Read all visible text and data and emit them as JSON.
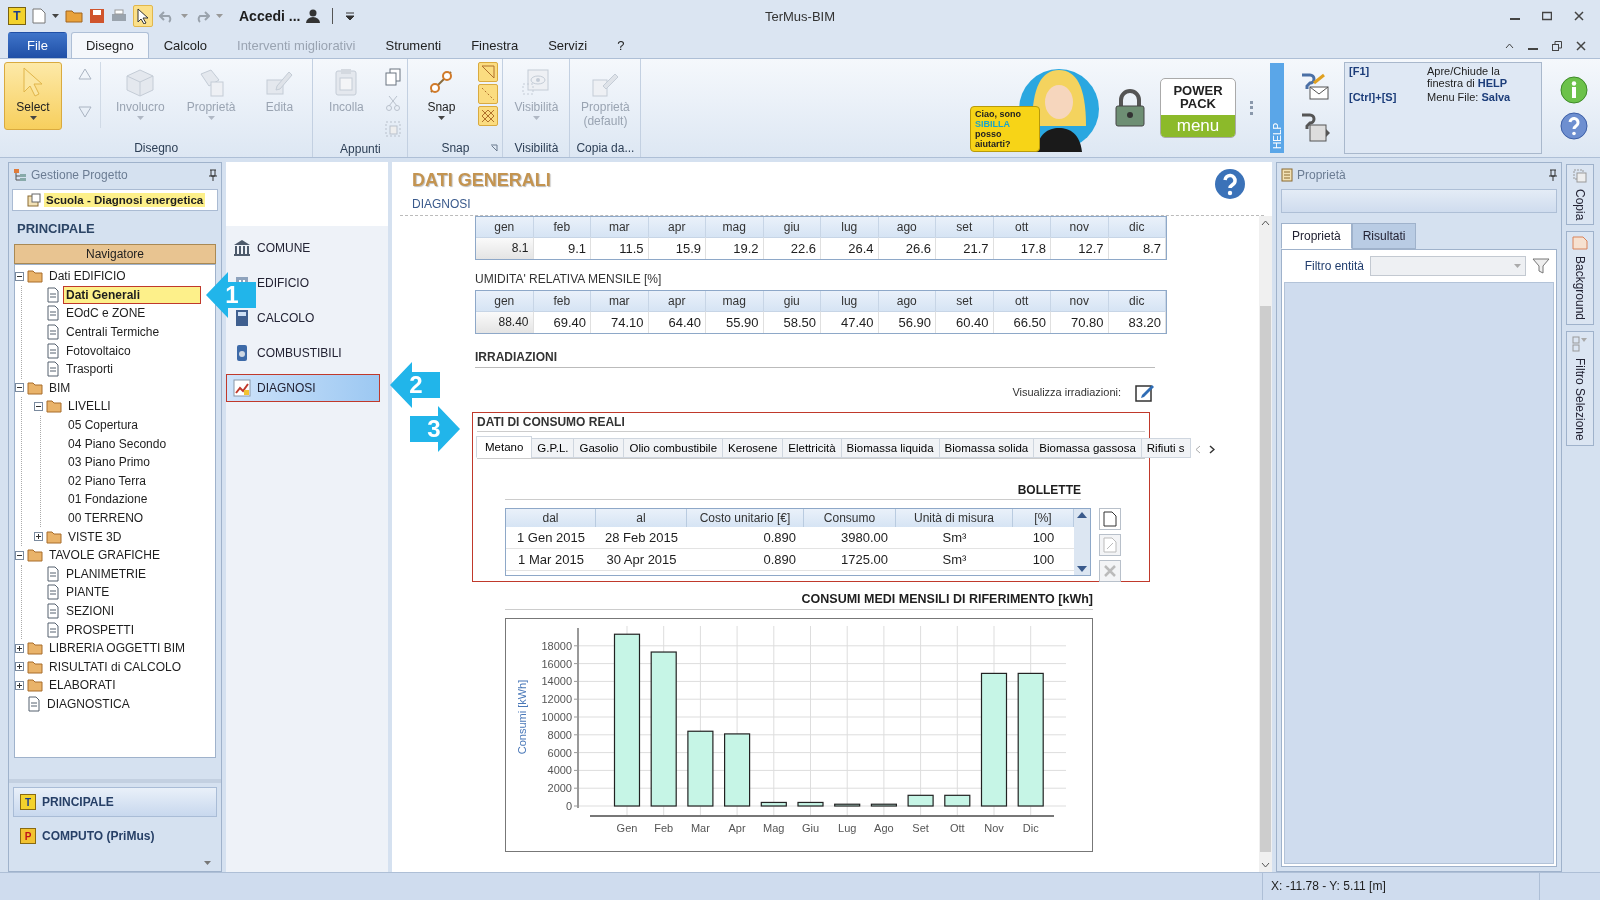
{
  "window": {
    "title": "TerMus-BIM",
    "app_logo": "T",
    "account": "Accedi ...",
    "pointer_tool_on": true
  },
  "ribbon_tabs": [
    {
      "label": "File",
      "kind": "file",
      "selected": false,
      "disabled": false
    },
    {
      "label": "Disegno",
      "kind": "tab",
      "selected": true,
      "disabled": false
    },
    {
      "label": "Calcolo",
      "kind": "tab",
      "selected": false,
      "disabled": false
    },
    {
      "label": "Interventi migliorativi",
      "kind": "tab",
      "selected": false,
      "disabled": true
    },
    {
      "label": "Strumenti",
      "kind": "tab",
      "selected": false,
      "disabled": false
    },
    {
      "label": "Finestra",
      "kind": "tab",
      "selected": false,
      "disabled": false
    },
    {
      "label": "Servizi",
      "kind": "tab",
      "selected": false,
      "disabled": false
    },
    {
      "label": "?",
      "kind": "tab",
      "selected": false,
      "disabled": false
    }
  ],
  "ribbon_groups": [
    {
      "label": "Disegno",
      "launcher": false,
      "buttons": [
        {
          "label": "Select",
          "active": true,
          "disabled": false,
          "dropdown": true
        },
        {
          "label": "Involucro",
          "active": false,
          "disabled": true,
          "dropdown": true
        },
        {
          "label": "Proprietà",
          "active": false,
          "disabled": true,
          "dropdown": true
        },
        {
          "label": "Edita",
          "active": false,
          "disabled": true,
          "dropdown": false
        }
      ]
    },
    {
      "label": "Appunti",
      "launcher": false,
      "buttons": [
        {
          "label": "Incolla",
          "active": false,
          "disabled": true,
          "dropdown": false
        }
      ],
      "small_buttons": [
        {
          "disabled": false
        },
        {
          "disabled": true
        },
        {
          "disabled": true
        }
      ]
    },
    {
      "label": "Snap",
      "launcher": true,
      "buttons": [
        {
          "label": "Snap",
          "active": false,
          "disabled": false,
          "dropdown": true
        }
      ],
      "toggles": [
        {
          "on": true
        },
        {
          "on": true
        },
        {
          "on": true
        }
      ]
    },
    {
      "label": "Visibilità",
      "launcher": false,
      "buttons": [
        {
          "label": "Visibilità",
          "active": false,
          "disabled": true,
          "dropdown": true
        }
      ]
    },
    {
      "label": "Copia da...",
      "launcher": false,
      "buttons": [
        {
          "label": "Proprietà (default)",
          "active": false,
          "disabled": true,
          "dropdown": false
        }
      ]
    }
  ],
  "assistant": {
    "bubble": "Ciao, sono **SIBILLA** posso aiutarti?"
  },
  "power_pack": {
    "title": "POWER PACK",
    "button": "menu"
  },
  "help_strip": "HELP",
  "shortcuts": [
    {
      "keys": "[F1]",
      "action": "Apre/Chiude la finestra di **HELP**"
    },
    {
      "keys": "[Ctrl]+[S]",
      "action": "Menu File: **Salva**"
    }
  ],
  "project_panel": {
    "title": "Gestione Progetto",
    "project": "Scuola - Diagnosi energetica",
    "section": "PRINCIPALE",
    "navigator": "Navigatore",
    "tree": [
      {
        "label": "Dati EDIFICIO",
        "kind": "group",
        "expanded": true,
        "selected": false,
        "children": [
          {
            "label": "Dati Generali",
            "kind": "node",
            "selected": true
          },
          {
            "label": "EOdC e ZONE",
            "kind": "node",
            "selected": false
          },
          {
            "label": "Centrali Termiche",
            "kind": "node",
            "selected": false
          },
          {
            "label": "Fotovoltaico",
            "kind": "node",
            "selected": false
          },
          {
            "label": "Trasporti",
            "kind": "node",
            "selected": false
          }
        ]
      },
      {
        "label": "BIM",
        "kind": "group",
        "expanded": true,
        "selected": false,
        "children": [
          {
            "label": "LIVELLI",
            "kind": "group",
            "expanded": true,
            "selected": false,
            "children": [
              {
                "label": "05 Copertura",
                "kind": "level",
                "selected": false
              },
              {
                "label": "04 Piano Secondo",
                "kind": "level",
                "selected": false
              },
              {
                "label": "03 Piano Primo",
                "kind": "level",
                "selected": false
              },
              {
                "label": "02 Piano Terra",
                "kind": "level",
                "selected": false
              },
              {
                "label": "01 Fondazione",
                "kind": "level",
                "selected": false
              },
              {
                "label": "00 TERRENO",
                "kind": "level",
                "selected": false
              }
            ]
          },
          {
            "label": "VISTE 3D",
            "kind": "group",
            "expanded": false,
            "selected": false
          }
        ]
      },
      {
        "label": "TAVOLE GRAFICHE",
        "kind": "group",
        "expanded": true,
        "selected": false,
        "children": [
          {
            "label": "PLANIMETRIE",
            "kind": "node",
            "selected": false
          },
          {
            "label": "PIANTE",
            "kind": "node",
            "selected": false
          },
          {
            "label": "SEZIONI",
            "kind": "node",
            "selected": false
          },
          {
            "label": "PROSPETTI",
            "kind": "node",
            "selected": false
          }
        ]
      },
      {
        "label": "LIBRERIA OGGETTI BIM",
        "kind": "group",
        "expanded": false,
        "selected": false
      },
      {
        "label": "RISULTATI di CALCOLO",
        "kind": "group",
        "expanded": false,
        "selected": false
      },
      {
        "label": "ELABORATI",
        "kind": "group",
        "expanded": false,
        "selected": false
      },
      {
        "label": "DIAGNOSTICA",
        "kind": "node",
        "selected": false
      }
    ],
    "modules": [
      {
        "label": "PRINCIPALE",
        "badge": "T",
        "selected": true
      },
      {
        "label": "COMPUTO (PriMus)",
        "badge": "P",
        "selected": false
      }
    ]
  },
  "sections": [
    {
      "label": "COMUNE",
      "selected": false
    },
    {
      "label": "EDIFICIO",
      "selected": false
    },
    {
      "label": "CALCOLO",
      "selected": false
    },
    {
      "label": "COMBUSTIBILI",
      "selected": false
    },
    {
      "label": "DIAGNOSI",
      "selected": true
    }
  ],
  "page": {
    "title": "DATI GENERALI",
    "subtitle": "DIAGNOSI"
  },
  "temperature_table": {
    "months": [
      "gen",
      "feb",
      "mar",
      "apr",
      "mag",
      "giu",
      "lug",
      "ago",
      "set",
      "ott",
      "nov",
      "dic"
    ],
    "values": [
      "8.1",
      "9.1",
      "11.5",
      "15.9",
      "19.2",
      "22.6",
      "26.4",
      "26.6",
      "21.7",
      "17.8",
      "12.7",
      "8.7"
    ]
  },
  "humidity_table": {
    "title": "UMIDITA' RELATIVA MENSILE [%]",
    "months": [
      "gen",
      "feb",
      "mar",
      "apr",
      "mag",
      "giu",
      "lug",
      "ago",
      "set",
      "ott",
      "nov",
      "dic"
    ],
    "values": [
      "88.40",
      "69.40",
      "74.10",
      "64.40",
      "55.90",
      "58.50",
      "47.40",
      "56.90",
      "60.40",
      "66.50",
      "70.80",
      "83.20"
    ]
  },
  "irradiazioni": {
    "title": "IRRADIAZIONI",
    "label": "Visualizza irradiazioni:"
  },
  "consumption": {
    "title": "DATI DI CONSUMO REALI",
    "fuel_tabs": [
      {
        "label": "Metano",
        "selected": true
      },
      {
        "label": "G.P.L.",
        "selected": false
      },
      {
        "label": "Gasolio",
        "selected": false
      },
      {
        "label": "Olio combustibile",
        "selected": false
      },
      {
        "label": "Kerosene",
        "selected": false
      },
      {
        "label": "Elettricità",
        "selected": false
      },
      {
        "label": "Biomassa liquida",
        "selected": false
      },
      {
        "label": "Biomassa solida",
        "selected": false
      },
      {
        "label": "Biomassa gassosa",
        "selected": false
      },
      {
        "label": "Rifiuti s",
        "selected": false
      }
    ],
    "bills": {
      "title": "BOLLETTE",
      "columns": [
        "dal",
        "al",
        "Costo unitario [€]",
        "Consumo",
        "Unità di misura",
        "[%]"
      ],
      "rows": [
        [
          "1 Gen 2015",
          "28 Feb 2015",
          "0.890",
          "3980.00",
          "Sm³",
          "100"
        ],
        [
          "1 Mar 2015",
          "30 Apr 2015",
          "0.890",
          "1725.00",
          "Sm³",
          "100"
        ]
      ]
    },
    "actions": [
      {
        "disabled": false
      },
      {
        "disabled": true
      },
      {
        "disabled": true
      }
    ]
  },
  "chart_section": {
    "chart_data": {
      "type": "bar",
      "title": "CONSUMI MEDI MENSILI DI RIFERIMENTO [kWh]",
      "ylabel": "Consumi [kWh]",
      "categories": [
        "Gen",
        "Feb",
        "Mar",
        "Apr",
        "Mag",
        "Giu",
        "Lug",
        "Ago",
        "Set",
        "Ott",
        "Nov",
        "Dic"
      ],
      "values": [
        19300,
        17300,
        8400,
        8100,
        400,
        400,
        200,
        200,
        1200,
        1200,
        14900,
        14900
      ],
      "grid": true,
      "ylim": [
        0,
        20000
      ],
      "yticks": [
        0,
        2000,
        4000,
        6000,
        8000,
        10000,
        12000,
        14000,
        16000,
        18000
      ]
    }
  },
  "properties_panel": {
    "title": "Proprietà",
    "tabs": [
      {
        "label": "Proprietà",
        "selected": true
      },
      {
        "label": "Risultati",
        "selected": false
      }
    ],
    "filter_label": "Filtro entità"
  },
  "side_tabs": [
    "Copia",
    "Background",
    "Filtro Selezione"
  ],
  "status_bar": {
    "coordinates": "X: -11.78 - Y: 5.11 [m]"
  },
  "callouts": [
    "1",
    "2",
    "3"
  ]
}
